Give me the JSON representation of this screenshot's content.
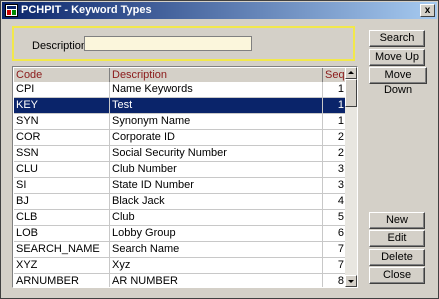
{
  "window": {
    "title": "PCHPIT - Keyword Types",
    "close_glyph": "x"
  },
  "search": {
    "description_label": "Description",
    "description_value": ""
  },
  "buttons": {
    "search": "Search",
    "move_up": "Move Up",
    "move_down": "Move Down",
    "new": "New",
    "edit": "Edit",
    "delete": "Delete",
    "close": "Close"
  },
  "table": {
    "headers": {
      "code": "Code",
      "description": "Description",
      "seq": "Seq."
    },
    "rows": [
      {
        "code": "CPI",
        "description": "Name Keywords",
        "seq": "1"
      },
      {
        "code": "KEY",
        "description": "Test",
        "seq": "1"
      },
      {
        "code": "SYN",
        "description": "Synonym Name",
        "seq": "1"
      },
      {
        "code": "COR",
        "description": "Corporate ID",
        "seq": "2"
      },
      {
        "code": "SSN",
        "description": "Social Security Number",
        "seq": "2"
      },
      {
        "code": "CLU",
        "description": "Club Number",
        "seq": "3"
      },
      {
        "code": "SI",
        "description": "State ID Number",
        "seq": "3"
      },
      {
        "code": "BJ",
        "description": "Black Jack",
        "seq": "4"
      },
      {
        "code": "CLB",
        "description": "Club",
        "seq": "5"
      },
      {
        "code": "LOB",
        "description": "Lobby Group",
        "seq": "6"
      },
      {
        "code": "SEARCH_NAME",
        "description": "Search Name",
        "seq": "7"
      },
      {
        "code": "XYZ",
        "description": "Xyz",
        "seq": "7"
      },
      {
        "code": "ARNUMBER",
        "description": "AR NUMBER",
        "seq": "8"
      }
    ],
    "selected_index": 1
  },
  "icons": {
    "app": "app-window-icon",
    "close": "close-icon",
    "scroll_up": "arrow-up-icon",
    "scroll_down": "arrow-down-icon"
  },
  "colors": {
    "selection": "#0a246a",
    "header_text": "#8b1a1a",
    "input_bg": "#fbf6dc",
    "panel_border": "#f2e84b"
  }
}
